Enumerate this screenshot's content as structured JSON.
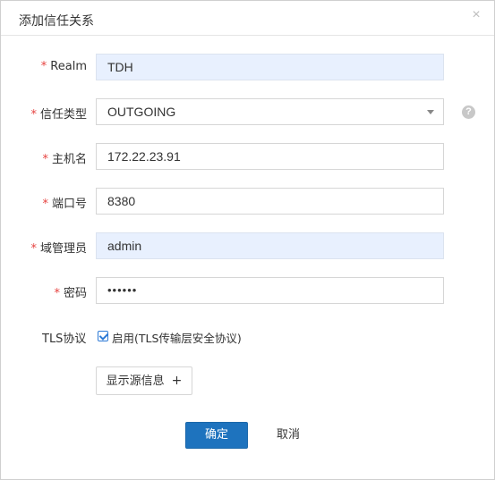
{
  "dialog": {
    "title": "添加信任关系",
    "close_icon": "close-icon"
  },
  "form": {
    "realm": {
      "label": "Realm",
      "required": "*",
      "value": "TDH"
    },
    "trust_type": {
      "label": "信任类型",
      "required": "*",
      "value": "OUTGOING",
      "help_icon": "help-icon",
      "help_text": "?"
    },
    "hostname": {
      "label": "主机名",
      "required": "*",
      "value": "172.22.23.91"
    },
    "port": {
      "label": "端口号",
      "required": "*",
      "value": "8380"
    },
    "domain_admin": {
      "label": "域管理员",
      "required": "*",
      "value": "admin"
    },
    "password": {
      "label": "密码",
      "required": "*",
      "value": "••••••"
    },
    "tls": {
      "label": "TLS协议",
      "checked": true,
      "option_text": "启用(TLS传输层安全协议)"
    }
  },
  "buttons": {
    "show_source_info": "显示源信息",
    "show_source_plus": "+",
    "ok": "确定",
    "cancel": "取消"
  },
  "colors": {
    "primary": "#1e73be",
    "required": "#e64340",
    "autofill_bg": "#e8f0fe"
  }
}
